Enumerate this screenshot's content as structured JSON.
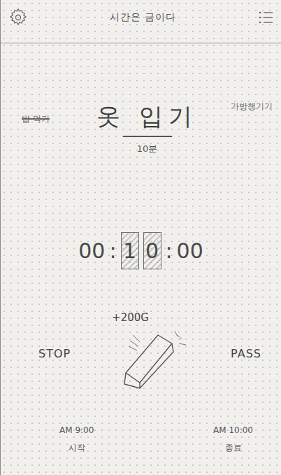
{
  "header": {
    "title": "시간은 금이다"
  },
  "tasks": [
    {
      "label": "밥 먹기",
      "selected": false,
      "done": true
    },
    {
      "label": "옷 입기",
      "selected": true,
      "done": false
    },
    {
      "label": "가방챙기기",
      "selected": false,
      "done": false
    }
  ],
  "duration": "10분",
  "timer": {
    "separator": ":",
    "groups": [
      {
        "text": "00",
        "highlighted": false
      },
      {
        "text": "10",
        "highlighted": true
      },
      {
        "text": "00",
        "highlighted": false
      }
    ]
  },
  "reward": "+200G",
  "actions": {
    "stop": "STOP",
    "pass": "PASS"
  },
  "schedule": [
    {
      "time": "AM 9:00",
      "label": "시작"
    },
    {
      "time": "AM 10:00",
      "label": "종료"
    }
  ]
}
